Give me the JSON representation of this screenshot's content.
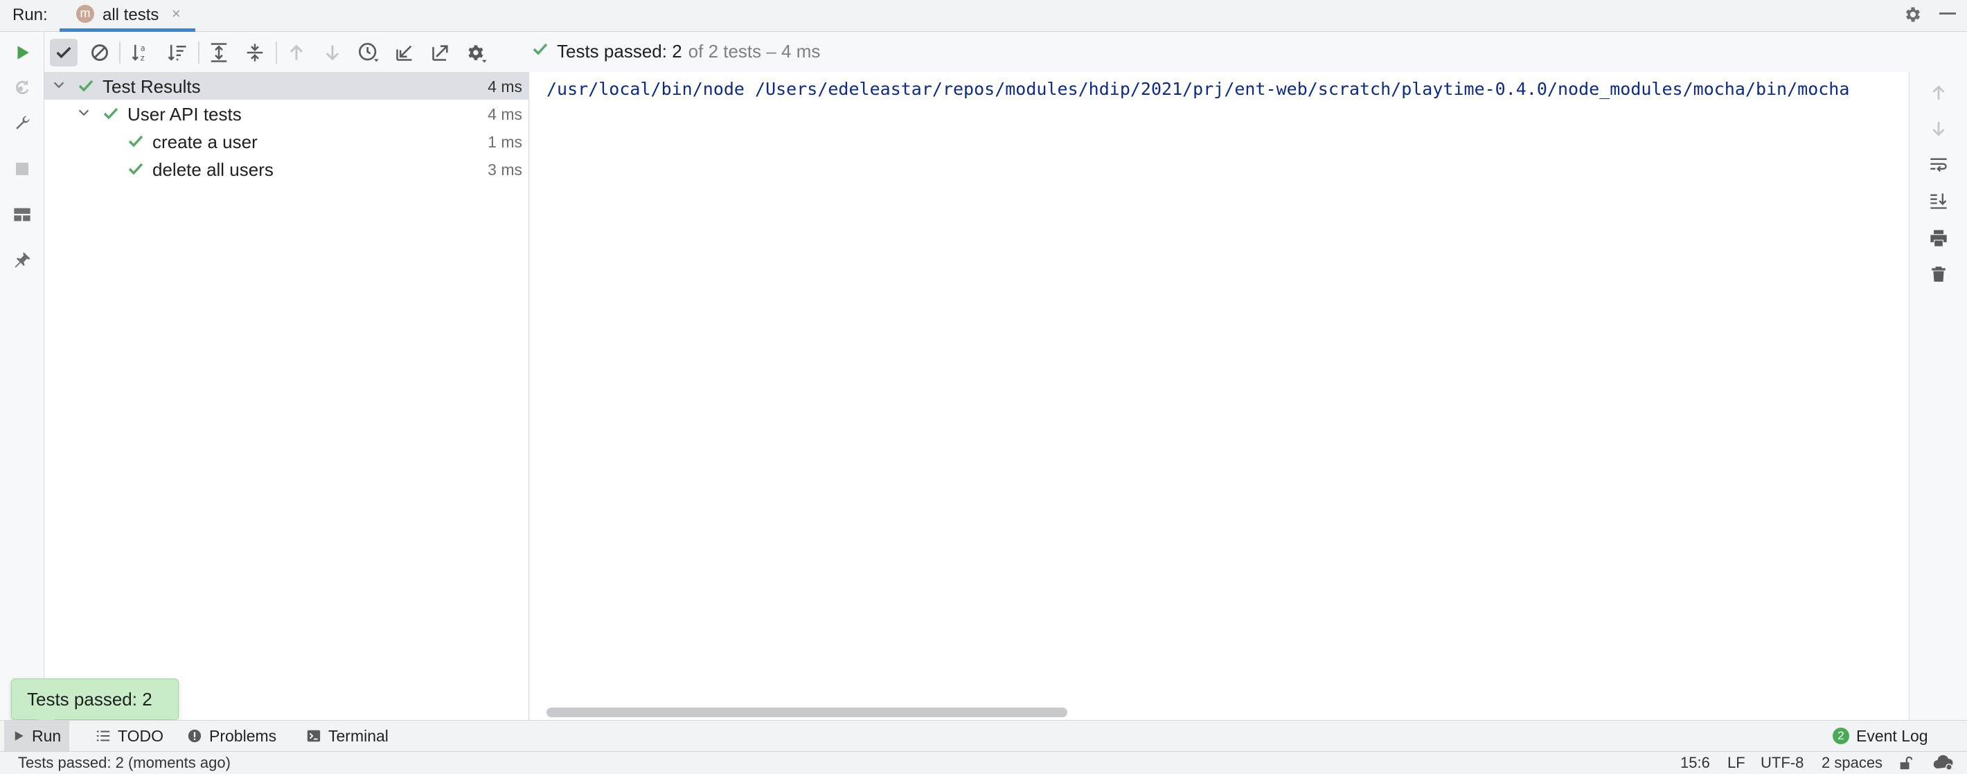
{
  "titlebar": {
    "run_label": "Run:",
    "tab": {
      "icon_letter": "m",
      "title": "all tests",
      "close": "×"
    }
  },
  "status_summary": {
    "prefix": "Tests passed: 2",
    "suffix": "of 2 tests – 4 ms"
  },
  "tree": {
    "rows": [
      {
        "name": "Test Results",
        "duration": "4 ms",
        "status": "passed",
        "expanded": true
      },
      {
        "name": "User API tests",
        "duration": "4 ms",
        "status": "passed",
        "expanded": true
      },
      {
        "name": "create a user",
        "duration": "1 ms",
        "status": "passed"
      },
      {
        "name": "delete all users",
        "duration": "3 ms",
        "status": "passed"
      }
    ]
  },
  "console": {
    "command": "/usr/local/bin/node /Users/edeleastar/repos/modules/hdip/2021/prj/ent-web/scratch/playtime-0.4.0/node_modules/mocha/bin/mocha"
  },
  "tooltip": {
    "text": "Tests passed: 2"
  },
  "bottom_tabs": {
    "run": "Run",
    "todo": "TODO",
    "problems": "Problems",
    "terminal": "Terminal",
    "event_log": "Event Log",
    "event_log_count": "2"
  },
  "statusbar": {
    "message": "Tests passed: 2 (moments ago)",
    "position": "15:6",
    "line_ending": "LF",
    "encoding": "UTF-8",
    "indent": "2 spaces"
  },
  "colors": {
    "pass_green": "#59a869",
    "run_green": "#4aa24f",
    "console_text": "#0b2a8a",
    "selection": "#dcdfe4",
    "tab_underline": "#4083c9"
  }
}
